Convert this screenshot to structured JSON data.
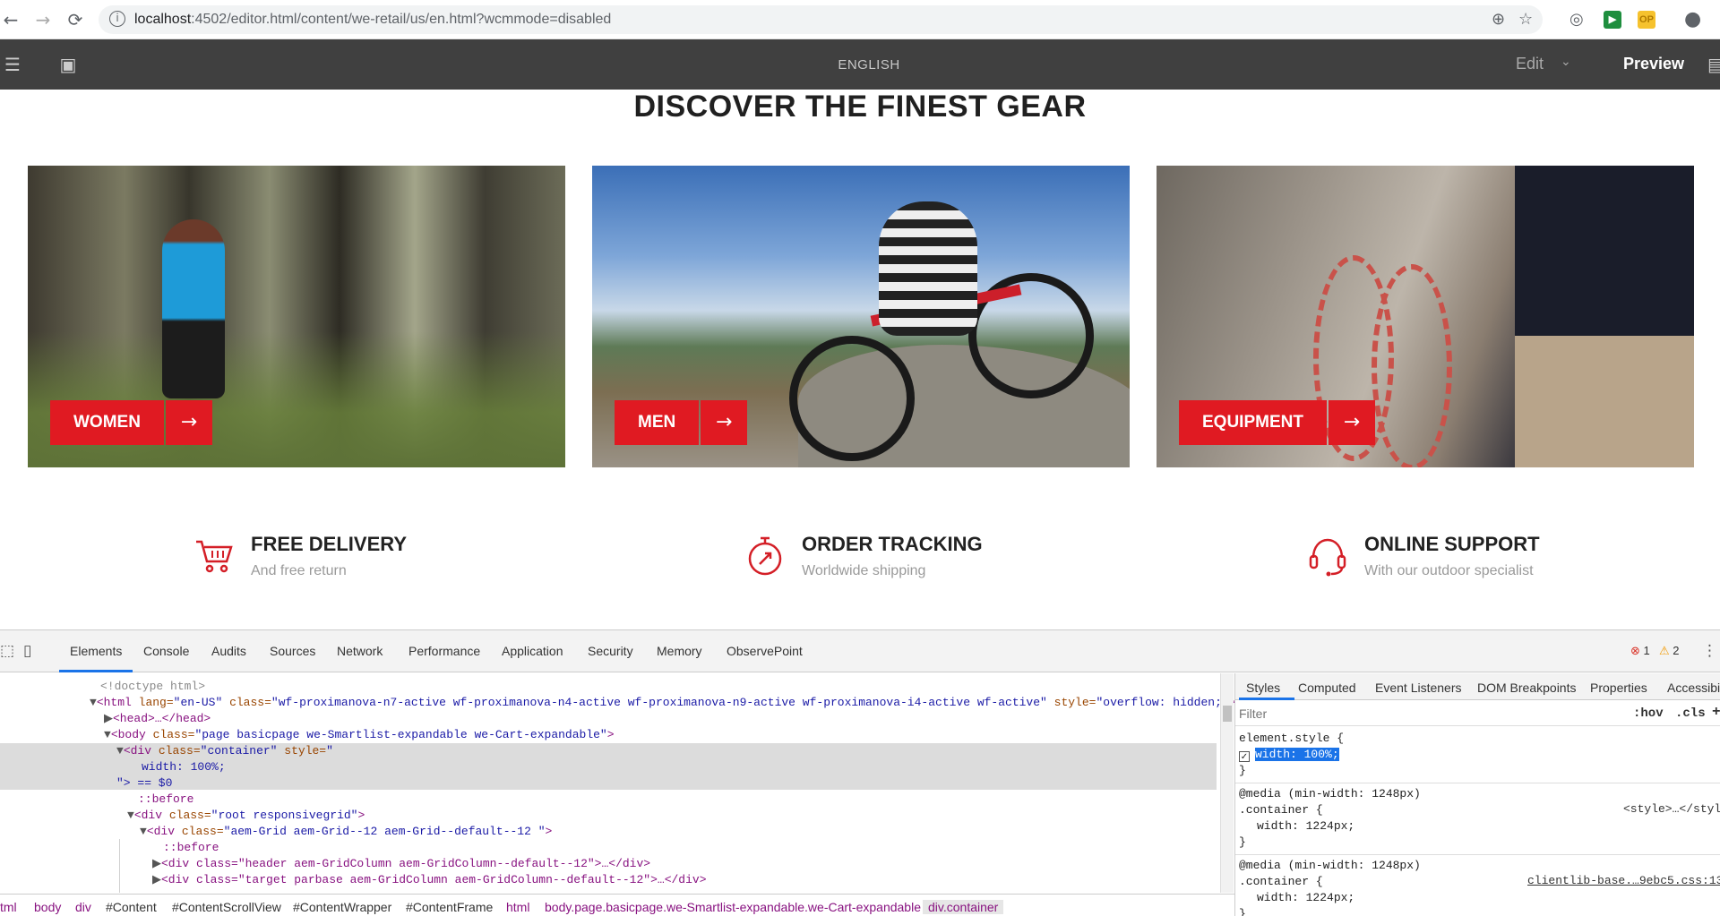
{
  "browser": {
    "url_host": "localhost",
    "url_rest": ":4502/editor.html/content/we-retail/us/en.html?wcmmode=disabled",
    "ext_green": "▶",
    "ext_yellow": "OP"
  },
  "editor_toolbar": {
    "language": "ENGLISH",
    "mode_edit": "Edit",
    "mode_preview": "Preview"
  },
  "page": {
    "headline": "DISCOVER THE FINEST GEAR",
    "cards": [
      {
        "label": "WOMEN",
        "arrow": "→"
      },
      {
        "label": "MEN",
        "arrow": "→"
      },
      {
        "label": "EQUIPMENT",
        "arrow": "→"
      }
    ],
    "features": [
      {
        "title": "FREE DELIVERY",
        "subtitle": "And free return",
        "icon": "cart-icon"
      },
      {
        "title": "ORDER TRACKING",
        "subtitle": "Worldwide shipping",
        "icon": "stopwatch-icon"
      },
      {
        "title": "ONLINE SUPPORT",
        "subtitle": "With our outdoor specialist",
        "icon": "headset-icon"
      }
    ]
  },
  "devtools": {
    "tabs": [
      "Elements",
      "Console",
      "Audits",
      "Sources",
      "Network",
      "Performance",
      "Application",
      "Security",
      "Memory",
      "ObservePoint"
    ],
    "errors": "1",
    "warnings": "2",
    "dom": {
      "doctype": "<!doctype html>",
      "html_open": "<html",
      "html_lang_attr": "lang=",
      "html_lang_val": "\"en-US\"",
      "html_class_attr": "class=",
      "html_class_val": "\"wf-proximanova-n7-active wf-proximanova-n4-active wf-proximanova-n9-active wf-proximanova-i4-active wf-active\"",
      "html_style_attr": "style=",
      "html_style_val": "\"overflow: hidden;\"",
      "html_close": ">",
      "head": "<head>…</head>",
      "body_open": "<body",
      "body_class_attr": "class=",
      "body_class_val": "\"page basicpage we-Smartlist-expandable we-Cart-expandable\"",
      "div_container_open": "<div",
      "div_container_class_attr": "class=",
      "div_container_class_val": "\"container\"",
      "div_container_style_attr": "style=",
      "div_container_style_val": "\"",
      "div_container_style_body": "width: 100%;",
      "div_container_close": "\"> == $0",
      "before1": "::before",
      "root_open": "<div",
      "root_class_attr": "class=",
      "root_class_val": "\"root responsivegrid\"",
      "grid_open": "<div",
      "grid_class_attr": "class=",
      "grid_class_val": "\"aem-Grid aem-Grid--12 aem-Grid--default--12 \"",
      "before2": "::before",
      "header_line": "<div class=\"header aem-GridColumn aem-GridColumn--default--12\">…</div>",
      "target_line": "<div class=\"target parbase aem-GridColumn aem-GridColumn--default--12\">…</div>"
    },
    "breadcrumbs": [
      "tml",
      "body",
      "div",
      "#Content",
      "#ContentScrollView",
      "#ContentWrapper",
      "#ContentFrame",
      "html",
      "body.page.basicpage.we-Smartlist-expandable.we-Cart-expandable",
      "div.container"
    ],
    "styles_tabs": [
      "Styles",
      "Computed",
      "Event Listeners",
      "DOM Breakpoints",
      "Properties",
      "Accessibili"
    ],
    "filter_placeholder": "Filter",
    "hov": ":hov",
    "cls": ".cls",
    "plus": "+",
    "rules": {
      "element_style": "element.style {",
      "element_prop": "width: 100%;",
      "close": "}",
      "media1": "@media (min-width: 1248px)",
      "container_sel": ".container {",
      "width_1224": "width: 1224px;",
      "style_src": "<style>…</style>",
      "media2": "@media (min-width: 1248px)",
      "clientlib_src": "clientlib-base.…9ebc5.css:13"
    }
  }
}
